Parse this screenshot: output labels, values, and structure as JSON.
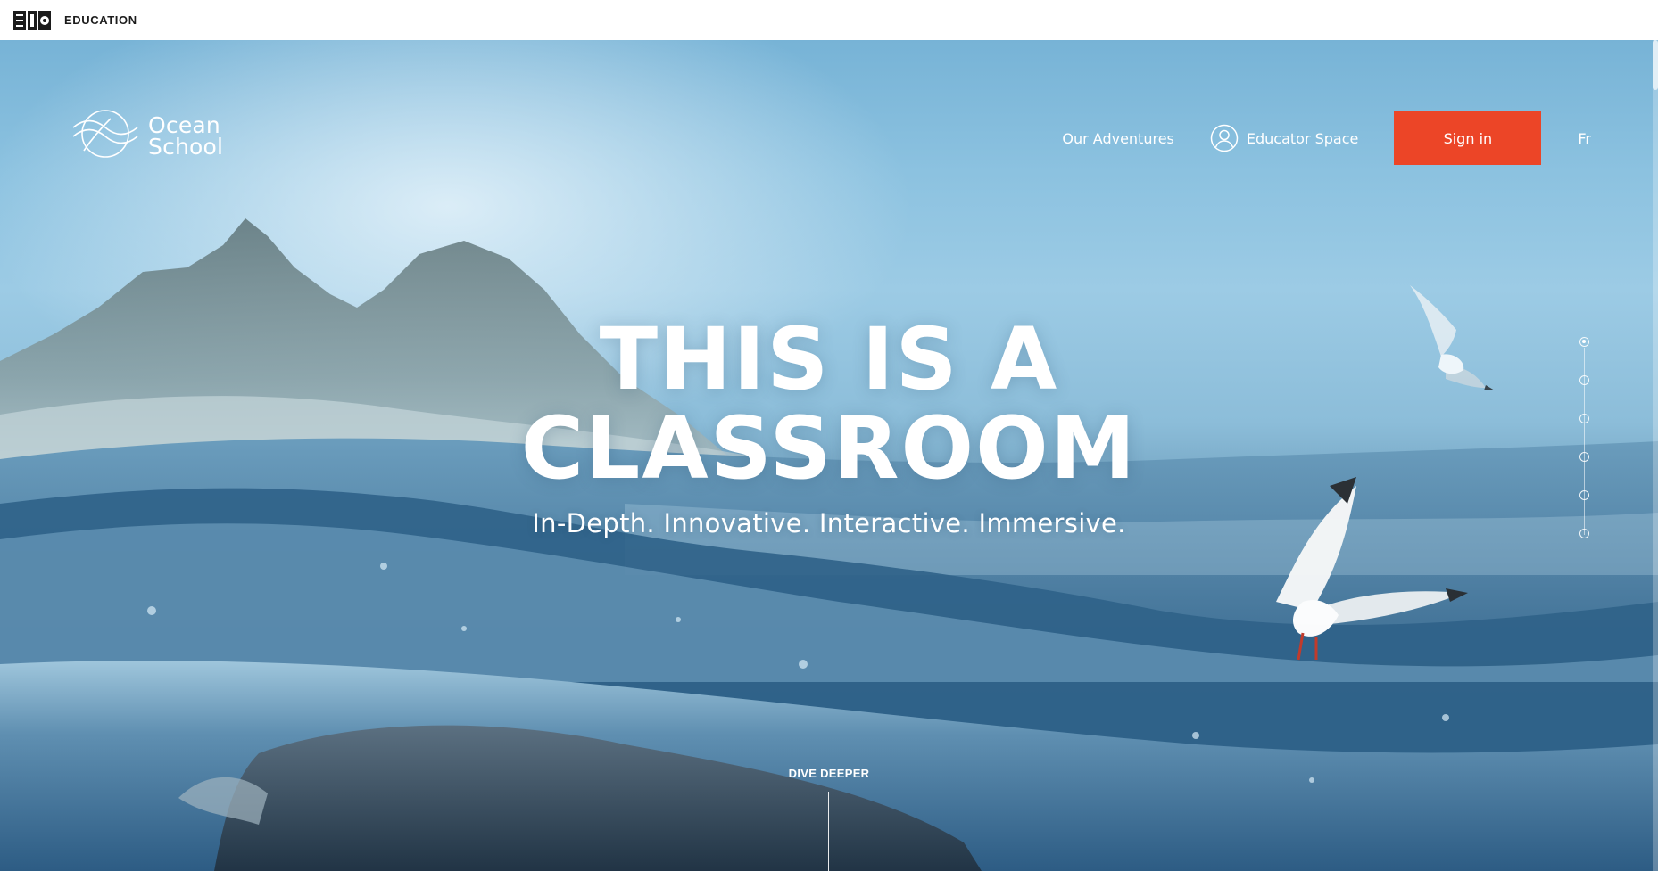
{
  "top_bar": {
    "logo_icon": "onf-nfb-icon",
    "label": "EDUCATION"
  },
  "site": {
    "logo_icon": "ocean-school-wave-icon",
    "logo_line1": "Ocean",
    "logo_line2": "School"
  },
  "nav": {
    "adventures": "Our Adventures",
    "educator_icon": "user-circle-icon",
    "educator": "Educator Space",
    "sign_in": "Sign in",
    "language": "Fr"
  },
  "hero": {
    "headline_line1": "THIS IS A",
    "headline_line2": "CLASSROOM",
    "subline": "In-Depth. Innovative. Interactive. Immersive.",
    "dive_deeper": "DIVE DEEPER"
  },
  "section_nav": {
    "total": 6,
    "active_index": 0
  },
  "colors": {
    "accent": "#ec4527",
    "text_on_hero": "#ffffff",
    "sky": "#8cc2e0",
    "water": "#2f5f82"
  }
}
